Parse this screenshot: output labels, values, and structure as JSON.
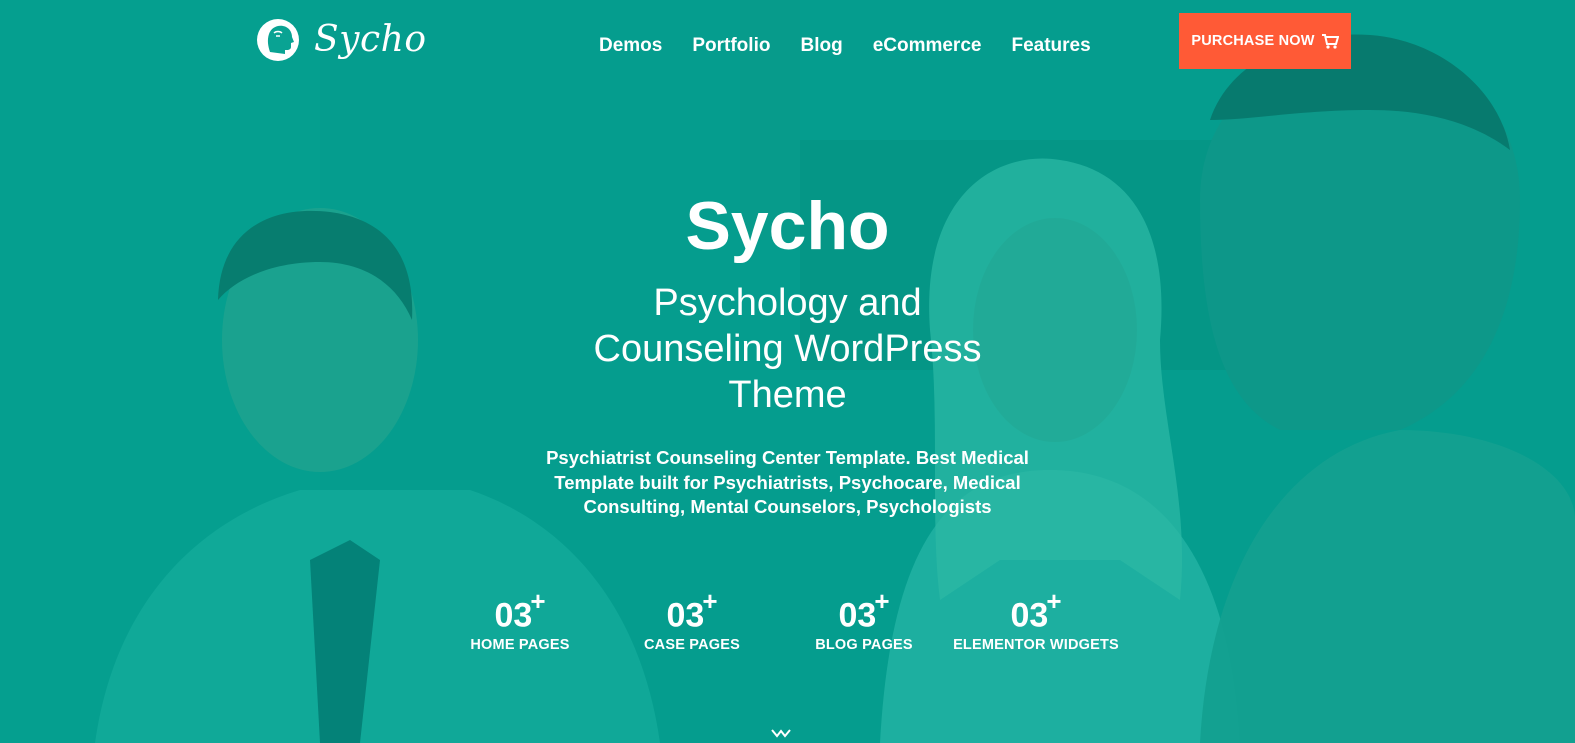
{
  "brand": {
    "name": "Sycho",
    "logo_icon": "head-brain-icon"
  },
  "nav": {
    "items": [
      {
        "label": "Demos"
      },
      {
        "label": "Portfolio"
      },
      {
        "label": "Blog"
      },
      {
        "label": "eCommerce"
      },
      {
        "label": "Features"
      }
    ]
  },
  "purchase": {
    "label": "PURCHASE NOW",
    "icon": "cart-icon",
    "color": "#ff5a36"
  },
  "hero": {
    "title": "Sycho",
    "subtitle_lines": [
      "Psychology and",
      "Counseling WordPress",
      "Theme"
    ],
    "description_lines": [
      "Psychiatrist Counseling Center Template. Best Medical",
      "Template built for Psychiatrists, Psychocare, Medical",
      "Consulting, Mental Counselors, Psychologists"
    ],
    "overlay_color": "#009688"
  },
  "stats": [
    {
      "number": "03",
      "suffix": "+",
      "label": "HOME PAGES"
    },
    {
      "number": "03",
      "suffix": "+",
      "label": "CASE PAGES"
    },
    {
      "number": "03",
      "suffix": "+",
      "label": "BLOG PAGES"
    },
    {
      "number": "03",
      "suffix": "+",
      "label": "ELEMENTOR WIDGETS"
    }
  ],
  "scroll_indicator": {
    "icon": "scroll-down-icon"
  }
}
